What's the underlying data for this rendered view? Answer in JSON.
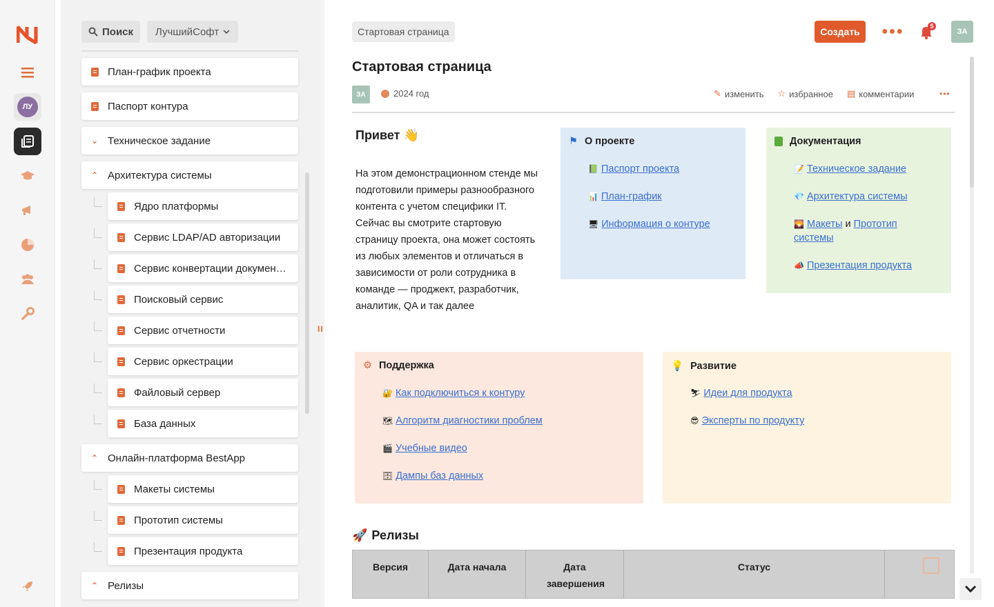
{
  "rail": {
    "avatar": "ЛУ",
    "icons": [
      "hamburger-icon",
      "avatar",
      "documents-icon",
      "graduation-cap-icon",
      "megaphone-icon",
      "pie-chart-icon",
      "team-icon",
      "wrench-icon",
      "rocket-icon"
    ]
  },
  "tree": {
    "search_label": "Поиск",
    "org_label": "ЛучшийСофт",
    "nodes": [
      "План-график проекта",
      "Паспорт контура",
      "Техническое задание",
      "Архитектура системы",
      "Ядро платформы",
      "Сервис LDAP/AD авторизации",
      "Сервис конвертации докумен…",
      "Поисковый сервис",
      "Сервис отчетности",
      "Сервис оркестрации",
      "Файловый сервер",
      "База данных",
      "Онлайн-платформа BestApp",
      "Макеты системы",
      "Прототип системы",
      "Презентация продукта",
      "Релизы"
    ]
  },
  "header": {
    "breadcrumb": "Стартовая страница",
    "create_label": "Создать",
    "notifications_count": "5",
    "user_initials": "ЗА"
  },
  "page": {
    "title": "Стартовая страница",
    "author_initials": "ЗА",
    "year": "2024 год",
    "actions": {
      "edit": "изменить",
      "favorite": "избранное",
      "comments": "комментарии"
    },
    "hello_title": "Привет",
    "hello_text": "На этом демонстрационном стенде мы подготовили примеры разнообразного контента с учетом специфики IT. Сейчас вы смотрите стартовую страницу проекта, она может состоять из любых элементов и отличаться в зависимости от роли сотрудника в команде — проджект, разработчик, аналитик, QA и так далее"
  },
  "panels": {
    "about": {
      "title": "О проекте",
      "links": [
        "Паспорт проекта",
        "План-график",
        "Информация о контуре"
      ]
    },
    "docs": {
      "title": "Документация",
      "links": [
        "Техническое задание",
        "Архитектура системы",
        "Макеты",
        "и",
        "Прототип системы",
        "Презентация продукта"
      ]
    },
    "support": {
      "title": "Поддержка",
      "links": [
        "Как подключиться к контуру",
        "Алгоритм диагностики проблем",
        "Учебные видео",
        "Дампы баз данных"
      ]
    },
    "growth": {
      "title": "Развитие",
      "links": [
        "Идеи для продукта",
        "Эксперты по продукту"
      ]
    }
  },
  "releases": {
    "title": "Релизы",
    "columns": [
      "Версия",
      "Дата начала",
      "Дата завершения",
      "Статус"
    ]
  },
  "colors": {
    "accent": "#e05a2b",
    "about_bg": "#dfeaf7",
    "docs_bg": "#e8f3de",
    "support_bg": "#fce8de",
    "growth_bg": "#fdf3e0"
  }
}
